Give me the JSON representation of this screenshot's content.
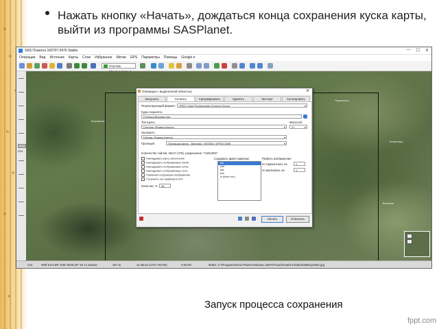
{
  "slide": {
    "bullet": "Нажать кнопку «Начать», дождаться конца сохранения куска карты, выйти из программы SASPlanet.",
    "caption": "Запуск процесса сохранения",
    "watermark": "fppt.com"
  },
  "window": {
    "title": "SAS.Планета 160707.9476 Stable",
    "controls": [
      "—",
      "☐",
      "✕"
    ],
    "menu": [
      "Операции",
      "Вид",
      "Источник",
      "Карты",
      "Слои",
      "Избранное",
      "Метки",
      "GPS",
      "Параметры",
      "Помощь",
      "Google ▾"
    ],
    "toolbar_combo": "Спутник (Яндекс.Карты)"
  },
  "map": {
    "zoom_label": "z14",
    "labels": [
      "Моршанск",
      "Кочетовка",
      "Подлесное",
      "Выселки"
    ]
  },
  "statusbar": {
    "zoom": "z14",
    "coords": "N66°54'4.89\" E36°3045.00\"",
    "scale": "10.71 м/пикс",
    "height": "267 м",
    "time": "11:38:43 (UTC+03:00)",
    "elapsed": "0:00:00",
    "file": "Файл: C:\\Programs\\SAS.Planet.Release.160707\\cache\\sat\\z14\\d54\\x6952\\y2662.jpg"
  },
  "dialog": {
    "title": "Операции с выделенной областью",
    "close": "✕",
    "tabs": [
      "Загрузить",
      "Склеить",
      "Сформировать",
      "Удалить",
      "Экспорт",
      "Скопировать"
    ],
    "active_tab_index": 1,
    "fields": {
      "format_label": "Результирующий формат:",
      "format_value": "JPEG (Joint Photographic Experts Group)",
      "save_to_label": "Куда сохранять:",
      "save_to_value": "D:\\Карты\\Браният.jpg",
      "map_type_label": "Тип карты:",
      "map_type_value": "Спутник (Яндекс.Карты)",
      "zoom_label": "Масштаб:",
      "zoom_value": "17",
      "overlay_label": "Наложить:",
      "overlay_value": "Гибрид (Яндекс.Карты)",
      "projection_label": "Проекция:",
      "projection_value": "Проекция карты - Mercator / WGS84 / EPSG:3395",
      "tiles_count": "Количество тайлов: 28x17 (476), разрешение: 7126x4057"
    },
    "checkboxes": [
      "Накладывать карту заполнения",
      "Накладывать отображаемые метки",
      "Накладывать отображаемые сетки",
      "Накладывать отображаемые слои",
      "Применить коррекцию изображения",
      "Сохранить гео-привязку в Exif"
    ],
    "quality_label": "Качество, %",
    "quality_value": "95",
    "geo_files_label": "Создавать файл привязки:",
    "geo_files": [
      ".tab",
      ".wld",
      ".dat",
      ".kml",
      ".w (short ext.)"
    ],
    "split_label": "Разбить изображение",
    "split_h_label": "по горизонтали, на",
    "split_h_value": "1",
    "split_v_label": "по вертикали, на",
    "split_v_value": "1",
    "start_button": "Начать",
    "cancel_button": "Отменить"
  }
}
